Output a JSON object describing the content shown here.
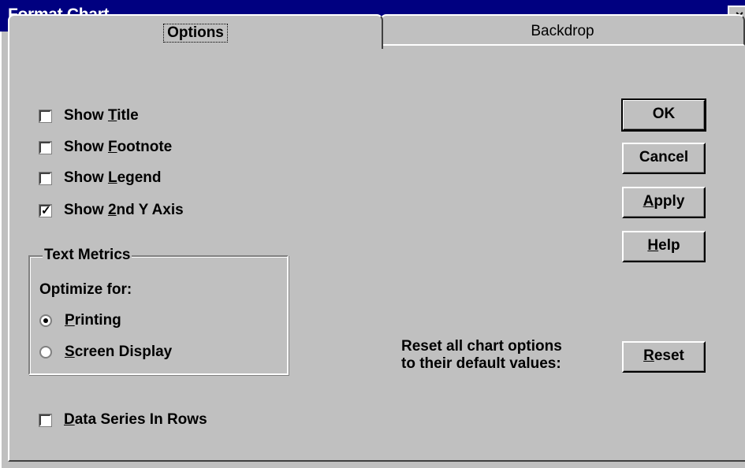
{
  "window": {
    "title": "Format Chart",
    "close_icon": "×"
  },
  "tabs": [
    {
      "label": "Options",
      "active": true
    },
    {
      "label": "Backdrop",
      "active": false
    }
  ],
  "checkboxes": {
    "show_title": {
      "pre": "Show ",
      "key": "T",
      "post": "itle",
      "checked": false
    },
    "show_footnote": {
      "pre": "Show ",
      "key": "F",
      "post": "ootnote",
      "checked": false
    },
    "show_legend": {
      "pre": "Show ",
      "key": "L",
      "post": "egend",
      "checked": false
    },
    "show_2nd_y_axis": {
      "pre": "Show ",
      "key": "2",
      "post": "nd Y Axis",
      "checked": true,
      "mark": "✓"
    },
    "data_series_in_rows": {
      "pre": "",
      "key": "D",
      "post": "ata Series In Rows",
      "checked": false
    }
  },
  "text_metrics": {
    "title": "Text Metrics",
    "optimize_label": "Optimize for:",
    "options": [
      {
        "key": "P",
        "post": "rinting",
        "selected": true
      },
      {
        "key": "S",
        "post": "creen Display",
        "selected": false
      }
    ]
  },
  "buttons": {
    "ok": "OK",
    "cancel": "Cancel",
    "apply": {
      "key": "A",
      "post": "pply"
    },
    "help": {
      "key": "H",
      "post": "elp"
    },
    "reset": {
      "key": "R",
      "post": "eset"
    }
  },
  "reset_text": {
    "line1": "Reset all chart options",
    "line2": "to their default values:"
  }
}
